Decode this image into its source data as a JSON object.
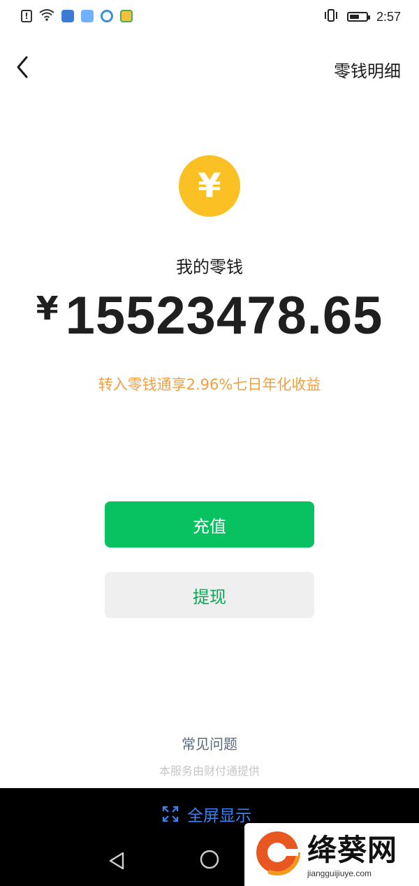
{
  "status_bar": {
    "time": "2:57",
    "left_icons": [
      "alert-icon",
      "wifi-icon",
      "sim-icon",
      "app-icon",
      "circle-app-icon",
      "green-app-icon"
    ],
    "right_icons": [
      "vibrate-icon",
      "battery-icon"
    ],
    "battery_level": 0.6
  },
  "header": {
    "back_icon": "chevron-left-icon",
    "title": "零钱明细"
  },
  "wallet": {
    "coin_symbol": "¥",
    "coin_color": "#fbc023",
    "label": "我的零钱",
    "currency": "¥",
    "balance": "15523478.65",
    "promo": "转入零钱通享2.96%七日年化收益",
    "promo_color": "#f0a042"
  },
  "actions": {
    "recharge_label": "充值",
    "withdraw_label": "提现",
    "primary_color": "#08c160"
  },
  "footer": {
    "faq": "常见问题",
    "provider": "本服务由财付通提供"
  },
  "nav": {
    "fullscreen_label": "全屏显示",
    "fullscreen_color": "#3b82f0"
  },
  "watermark": {
    "brand": "绛葵网",
    "url": "jiangguijiuye.com"
  }
}
